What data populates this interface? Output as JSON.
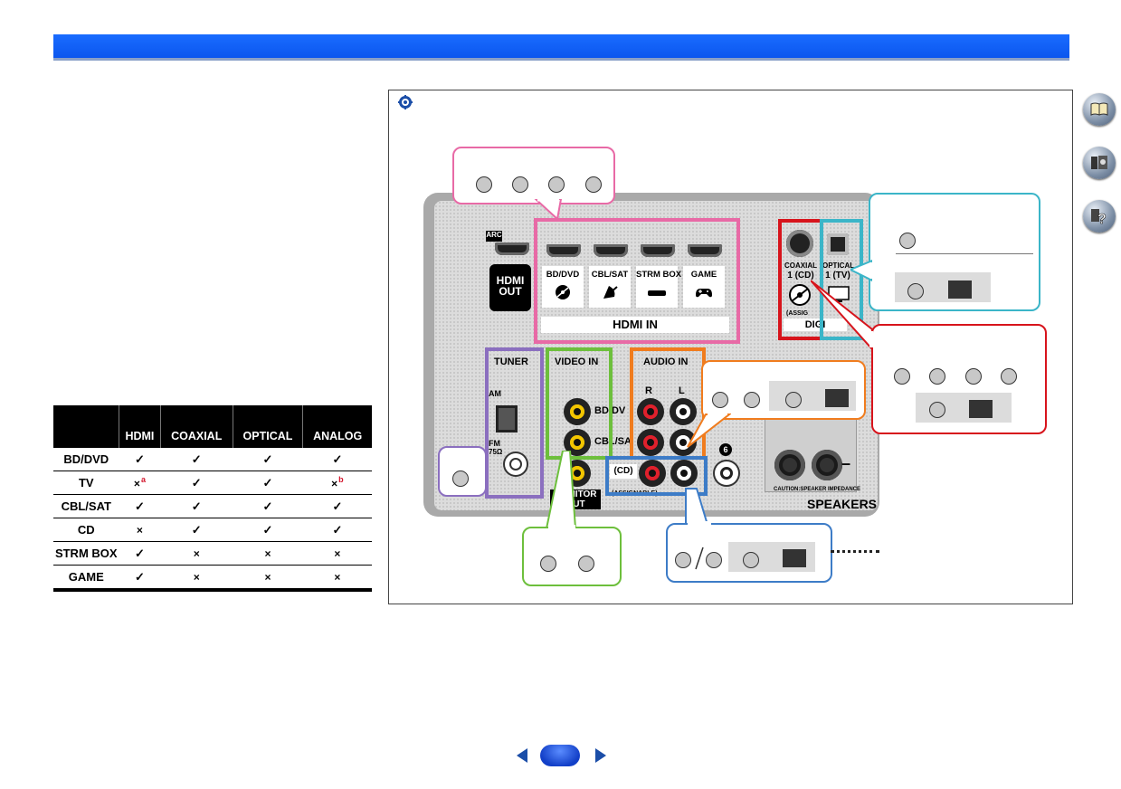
{
  "table": {
    "columns": [
      "HDMI",
      "COAXIAL",
      "OPTICAL",
      "ANALOG"
    ],
    "rows": [
      {
        "device": "BD/DVD",
        "cells": [
          "✓",
          "✓",
          "✓",
          "✓"
        ]
      },
      {
        "device": "TV",
        "cells": [
          "×",
          "✓",
          "✓",
          "×"
        ],
        "notes": [
          "a",
          "",
          "",
          "b"
        ]
      },
      {
        "device": "CBL/SAT",
        "cells": [
          "✓",
          "✓",
          "✓",
          "✓"
        ]
      },
      {
        "device": "CD",
        "cells": [
          "×",
          "✓",
          "✓",
          "✓"
        ]
      },
      {
        "device": "STRM BOX",
        "cells": [
          "✓",
          "×",
          "×",
          "×"
        ]
      },
      {
        "device": "GAME",
        "cells": [
          "✓",
          "×",
          "×",
          "×"
        ]
      }
    ]
  },
  "panel": {
    "arc": "ARC",
    "hdmi_out": "HDMI OUT",
    "hdmi_inputs": [
      "BD/DVD",
      "CBL/SAT",
      "STRM BOX",
      "GAME"
    ],
    "hdmi_in": "HDMI IN",
    "coaxial_1": "COAXIAL",
    "coaxial_2": "1 (CD)",
    "optical_1": "OPTICAL",
    "optical_2": "1 (TV)",
    "assign": "(ASSIG",
    "digital": "DIGI",
    "tuner": "TUNER",
    "am": "AM",
    "fm": "FM",
    "ohm": "75Ω",
    "video_in": "VIDEO IN",
    "video_row1": "BD/DV",
    "video_row2": "CBL/SA",
    "monitor_out": "MONITOR OUT",
    "audio_in": "AUDIO IN",
    "r": "R",
    "l": "L",
    "cd": "(CD)",
    "assignable": "(ASSIGNABLE)",
    "six": "6",
    "caution": "CAUTION:SPEAKER IMPEDANCE",
    "speakers": "SPEAKERS"
  },
  "colors": {
    "header": "#0b56ee",
    "hdmi": "#e86aa6",
    "tuner": "#8b6fbf",
    "video": "#6dbf3c",
    "audio": "#f07c1e",
    "coax": "#d7141c",
    "optical": "#3bb5c8",
    "analog_cd": "#3d7cc7"
  },
  "icons": [
    "tip-icon",
    "manual-icon",
    "receiver-icon",
    "help-icon",
    "prev-page-icon",
    "next-page-icon"
  ]
}
